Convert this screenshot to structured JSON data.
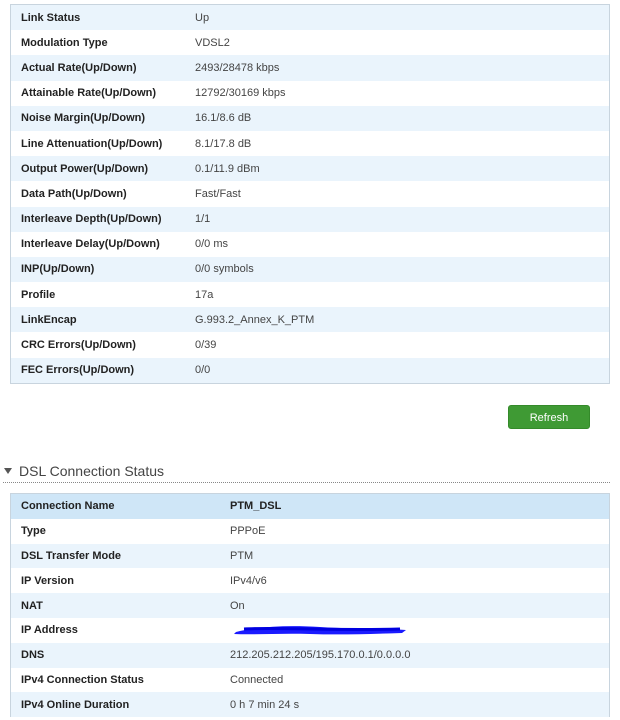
{
  "dsl_status": {
    "rows": [
      {
        "label": "Link Status",
        "value": "Up"
      },
      {
        "label": "Modulation Type",
        "value": "VDSL2"
      },
      {
        "label": "Actual Rate(Up/Down)",
        "value": "2493/28478 kbps"
      },
      {
        "label": "Attainable Rate(Up/Down)",
        "value": "12792/30169 kbps"
      },
      {
        "label": "Noise Margin(Up/Down)",
        "value": "16.1/8.6 dB"
      },
      {
        "label": "Line Attenuation(Up/Down)",
        "value": "8.1/17.8 dB"
      },
      {
        "label": "Output Power(Up/Down)",
        "value": "0.1/11.9 dBm"
      },
      {
        "label": "Data Path(Up/Down)",
        "value": "Fast/Fast"
      },
      {
        "label": "Interleave Depth(Up/Down)",
        "value": "1/1"
      },
      {
        "label": "Interleave Delay(Up/Down)",
        "value": "0/0 ms"
      },
      {
        "label": "INP(Up/Down)",
        "value": "0/0 symbols"
      },
      {
        "label": "Profile",
        "value": "17a"
      },
      {
        "label": "LinkEncap",
        "value": "G.993.2_Annex_K_PTM"
      },
      {
        "label": "CRC Errors(Up/Down)",
        "value": "0/39"
      },
      {
        "label": "FEC Errors(Up/Down)",
        "value": "0/0"
      }
    ]
  },
  "refresh_label": "Refresh",
  "connection_section": {
    "title": "DSL Connection Status",
    "header": {
      "label": "Connection Name",
      "value": "PTM_DSL"
    },
    "rows": [
      {
        "label": "Type",
        "value": "PPPoE"
      },
      {
        "label": "DSL Transfer Mode",
        "value": "PTM"
      },
      {
        "label": "IP Version",
        "value": "IPv4/v6"
      },
      {
        "label": "NAT",
        "value": "On"
      },
      {
        "label": "IP Address",
        "value": ""
      },
      {
        "label": "DNS",
        "value": "212.205.212.205/195.170.0.1/0.0.0.0"
      },
      {
        "label": "IPv4 Connection Status",
        "value": "Connected"
      },
      {
        "label": "IPv4 Online Duration",
        "value": "0 h 7 min 24 s"
      }
    ]
  },
  "colors": {
    "accent_green": "#3f9a34",
    "row_alt": "#eaf4fc",
    "header_row": "#cfe6f7",
    "redaction": "#1a1aff"
  }
}
